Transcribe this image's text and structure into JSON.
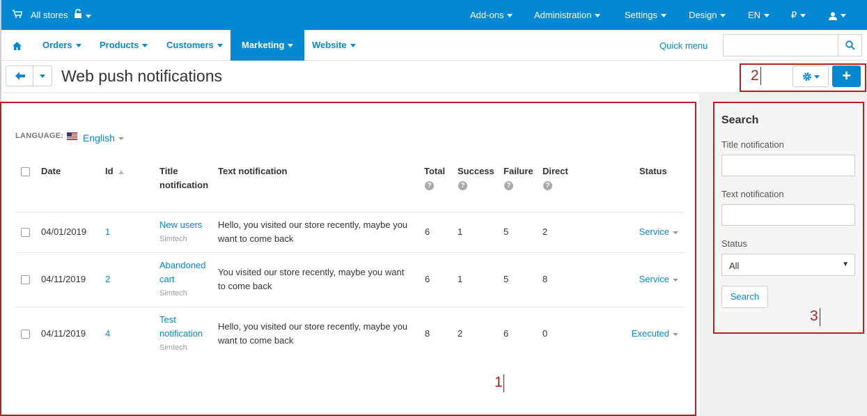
{
  "topbar": {
    "store_label": "All stores",
    "nav": [
      "Add-ons",
      "Administration",
      "Settings",
      "Design",
      "EN",
      "₽",
      ""
    ]
  },
  "mainnav": {
    "items": [
      "Orders",
      "Products",
      "Customers",
      "Marketing",
      "Website"
    ],
    "active": "Marketing",
    "quick_menu": "Quick menu",
    "search_value": ""
  },
  "page": {
    "title": "Web push notifications"
  },
  "language": {
    "label": "LANGUAGE:",
    "value": "English"
  },
  "table": {
    "headers": {
      "date": "Date",
      "id": "Id",
      "title_1": "Title",
      "title_2": "notification",
      "text": "Text notification",
      "total": "Total",
      "success": "Success",
      "failure": "Failure",
      "direct": "Direct",
      "status": "Status"
    },
    "rows": [
      {
        "date": "04/01/2019",
        "id": "1",
        "title_1": "New users",
        "title_2": "",
        "company": "Simtech",
        "text_1": "Hello, you visited our store recently, maybe you",
        "text_2": "want to come back",
        "total": "6",
        "success": "1",
        "failure": "5",
        "direct": "2",
        "status": "Service"
      },
      {
        "date": "04/11/2019",
        "id": "2",
        "title_1": "Abandoned",
        "title_2": "cart",
        "company": "Simtech",
        "text_1": "You visited our store recently, maybe you want",
        "text_2": "to come back",
        "total": "6",
        "success": "1",
        "failure": "5",
        "direct": "8",
        "status": "Service"
      },
      {
        "date": "04/11/2019",
        "id": "4",
        "title_1": "Test",
        "title_2": "notification",
        "company": "Simtech",
        "text_1": "Hello, you visited our store recently, maybe you",
        "text_2": "want to come back",
        "total": "8",
        "success": "2",
        "failure": "6",
        "direct": "0",
        "status": "Executed"
      }
    ]
  },
  "search_panel": {
    "heading": "Search",
    "title_label": "Title notification",
    "title_value": "",
    "text_label": "Text notification",
    "text_value": "",
    "status_label": "Status",
    "status_value": "All",
    "button": "Search"
  },
  "annotations": [
    "1",
    "2",
    "3"
  ],
  "colors": {
    "accent": "#0389d2",
    "annotation": "#b22222"
  }
}
